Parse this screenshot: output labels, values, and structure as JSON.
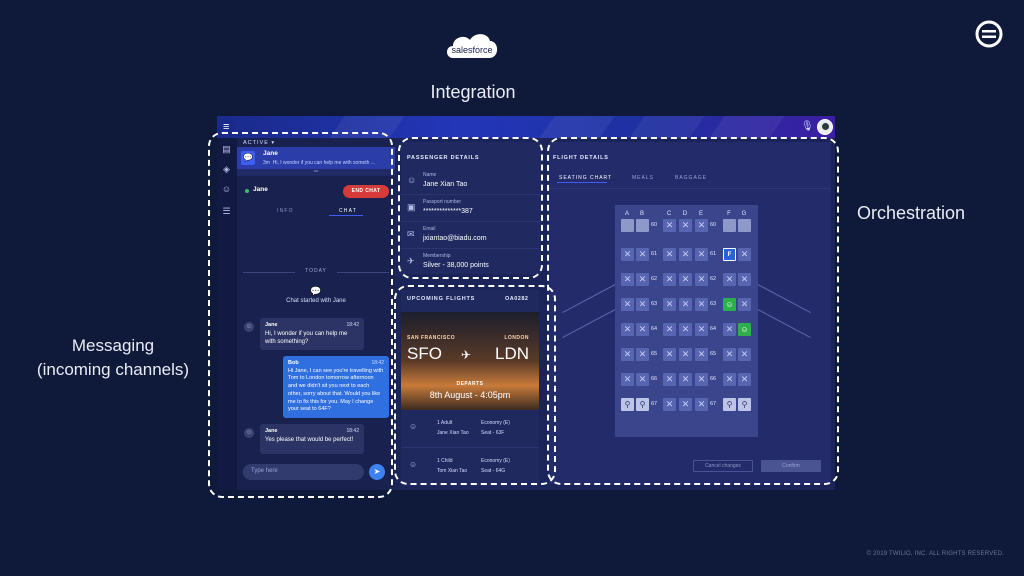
{
  "header": {
    "integration_label": "Integration",
    "salesforce_logo_text": "salesforce",
    "orchestration_label": "Orchestration",
    "messaging_label_line1": "Messaging",
    "messaging_label_line2": "(incoming channels)",
    "copyright": "© 2019 TWILIO, INC. ALL RIGHTS RESERVED."
  },
  "chat": {
    "status_filter": "ACTIVE",
    "conversation": {
      "name": "Jane",
      "age": "3m",
      "preview": "Hi, I wonder if you can help me with someth ..."
    },
    "contact_name": "Jane",
    "end_chat_label": "END CHAT",
    "tabs": [
      "INFO",
      "CHAT"
    ],
    "day_divider": "TODAY",
    "chat_started": "Chat started with Jane",
    "messages": [
      {
        "author": "Jane",
        "time": "18:42",
        "text": "Hi, I wonder if you can help me with something?"
      },
      {
        "author": "Bob",
        "time": "18:42",
        "text": "Hi Jane, I can see you're travelling with Tom to London tomorrow afternoon and we didn't sit you next to each other, sorry about that. Would you like me to fix this for you. May I change your seat to 64F?"
      },
      {
        "author": "Jane",
        "time": "18:42",
        "text": "Yes please that would be perfect!"
      }
    ],
    "input_placeholder": "Type here"
  },
  "passenger": {
    "title": "PASSENGER DETAILS",
    "fields": [
      {
        "label": "Name",
        "value": "Jane Xian Tao",
        "icon": "person-icon"
      },
      {
        "label": "Passport number",
        "value": "**************387",
        "icon": "passport-icon"
      },
      {
        "label": "Email",
        "value": "jxiantao@biadu.com",
        "icon": "email-icon"
      },
      {
        "label": "Membership",
        "value": "Silver - 38,000 points",
        "icon": "plane-icon"
      }
    ]
  },
  "flights": {
    "title": "UPCOMING FLIGHTS",
    "flight_number": "OA0282",
    "origin_city": "SAN FRANCISCO",
    "origin_code": "SFO",
    "destination_city": "LONDON",
    "destination_code": "LDN",
    "departs_label": "DEPARTS",
    "departs_time": "8th August - 4:05pm",
    "travellers": [
      {
        "count": "1 Adult",
        "name": "Jane Xian Tao",
        "class": "Economy (E)",
        "seat": "Seat - 63F"
      },
      {
        "count": "1 Child",
        "name": "Tom Xian Tao",
        "class": "Economy (E)",
        "seat": "Seat - 64G"
      }
    ]
  },
  "flight_details": {
    "title": "FLIGHT DETAILS",
    "tabs": [
      "SEATING CHART",
      "MEALS",
      "BAGGAGE"
    ],
    "columns": [
      "A",
      "B",
      "C",
      "D",
      "E",
      "F",
      "G"
    ],
    "rows": [
      "60",
      "61",
      "62",
      "63",
      "64",
      "65",
      "66",
      "67"
    ],
    "selected_seat_label": "F",
    "cancel_label": "Cancel changes",
    "confirm_label": "Confirm"
  }
}
